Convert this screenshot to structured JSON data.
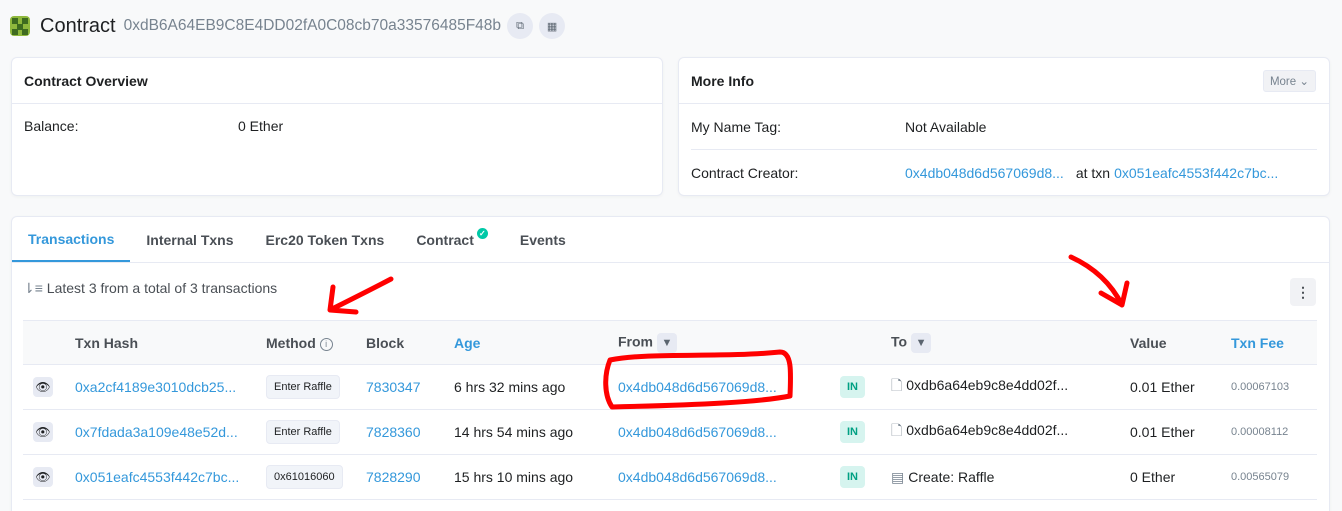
{
  "header": {
    "title": "Contract",
    "address": "0xdB6A64EB9C8E4DD02fA0C08cb70a33576485F48b"
  },
  "overview": {
    "title": "Contract Overview",
    "balance_label": "Balance:",
    "balance_value": "0 Ether"
  },
  "more_info": {
    "title": "More Info",
    "more_button": "More",
    "name_tag_label": "My Name Tag:",
    "name_tag_value": "Not Available",
    "creator_label": "Contract Creator:",
    "creator_address": "0x4db048d6d567069d8...",
    "at_txn": "at txn",
    "creator_txn": "0x051eafc4553f442c7bc..."
  },
  "tabs": [
    {
      "label": "Transactions",
      "active": true
    },
    {
      "label": "Internal Txns"
    },
    {
      "label": "Erc20 Token Txns"
    },
    {
      "label": "Contract"
    },
    {
      "label": "Events"
    }
  ],
  "summary": "Latest 3 from a total of 3 transactions",
  "table": {
    "headers": {
      "txn_hash": "Txn Hash",
      "method": "Method",
      "block": "Block",
      "age": "Age",
      "from": "From",
      "to": "To",
      "value": "Value",
      "txn_fee": "Txn Fee"
    },
    "rows": [
      {
        "hash": "0xa2cf4189e3010dcb25...",
        "method": "Enter Raffle",
        "block": "7830347",
        "age": "6 hrs 32 mins ago",
        "from": "0x4db048d6d567069d8...",
        "dir": "IN",
        "to": "0xdb6a64eb9c8e4dd02f...",
        "value": "0.01 Ether",
        "fee": "0.00067103"
      },
      {
        "hash": "0x7fdada3a109e48e52d...",
        "method": "Enter Raffle",
        "block": "7828360",
        "age": "14 hrs 54 mins ago",
        "from": "0x4db048d6d567069d8...",
        "dir": "IN",
        "to": "0xdb6a64eb9c8e4dd02f...",
        "value": "0.01 Ether",
        "fee": "0.00008112"
      },
      {
        "hash": "0x051eafc4553f442c7bc...",
        "method": "0x61016060",
        "block": "7828290",
        "age": "15 hrs 10 mins ago",
        "from": "0x4db048d6d567069d8...",
        "dir": "IN",
        "to": "Create: Raffle",
        "value": "0 Ether",
        "fee": "0.00565079"
      }
    ]
  },
  "colors": {
    "link": "#3498db",
    "annotation": "#ff0000",
    "in_badge": "#00a083"
  }
}
